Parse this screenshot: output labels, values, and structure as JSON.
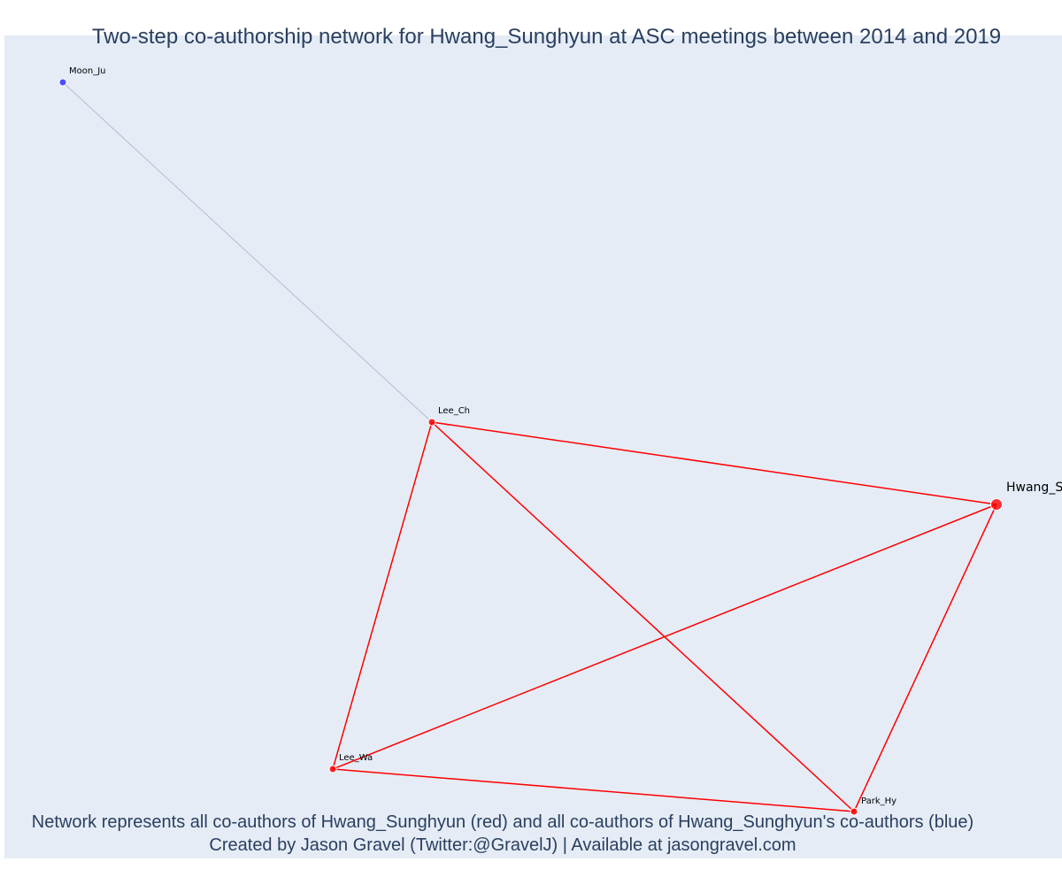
{
  "title": "Two-step co-authorship network for Hwang_Sunghyun at ASC meetings between 2014 and 2019",
  "caption": {
    "line1": "Network represents all co-authors of Hwang_Sunghyun (red) and all co-authors of Hwang_Sunghyun's co-authors (blue)",
    "line2": "Created by Jason Gravel (Twitter:@GravelJ) | Available at jasongravel.com"
  },
  "colors": {
    "background": "#e5ecf6",
    "first_step": "#ff0000",
    "second_step": "#3333ff",
    "second_step_edge": "#b8bccb",
    "text": "#2a3f5f"
  },
  "nodes": [
    {
      "id": "Hwang_Sunghyun",
      "label": "Hwang_S",
      "group": "focal"
    },
    {
      "id": "Lee_Ch",
      "label": "Lee_Ch",
      "group": "coauthor"
    },
    {
      "id": "Lee_Wa",
      "label": "Lee_Wa",
      "group": "coauthor"
    },
    {
      "id": "Park_Hy",
      "label": "Park_Hy",
      "group": "coauthor"
    },
    {
      "id": "Moon_Ju",
      "label": "Moon_Ju",
      "group": "second-step"
    }
  ],
  "edges": [
    {
      "source": "Lee_Ch",
      "target": "Hwang_Sunghyun",
      "type": "first-step"
    },
    {
      "source": "Lee_Ch",
      "target": "Lee_Wa",
      "type": "first-step"
    },
    {
      "source": "Lee_Ch",
      "target": "Park_Hy",
      "type": "first-step"
    },
    {
      "source": "Lee_Wa",
      "target": "Hwang_Sunghyun",
      "type": "first-step"
    },
    {
      "source": "Lee_Wa",
      "target": "Park_Hy",
      "type": "first-step"
    },
    {
      "source": "Park_Hy",
      "target": "Hwang_Sunghyun",
      "type": "first-step"
    },
    {
      "source": "Moon_Ju",
      "target": "Lee_Ch",
      "type": "second-step"
    }
  ]
}
